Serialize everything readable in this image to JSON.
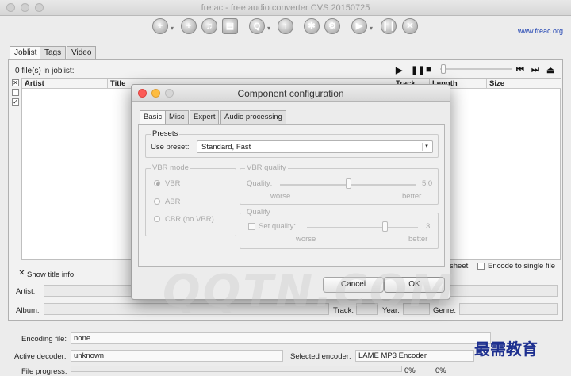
{
  "window": {
    "title": "fre:ac - free audio converter CVS 20150725",
    "link": "www.freac.org"
  },
  "main_tabs": [
    "Joblist",
    "Tags",
    "Video"
  ],
  "joblist": {
    "file_count": "0 file(s) in joblist:",
    "columns": [
      "Artist",
      "Title",
      "Track",
      "Length",
      "Size"
    ]
  },
  "tag_panel": {
    "show_title_info": "Show title info",
    "artist_label": "Artist:",
    "album_label": "Album:",
    "track_label": "Track:",
    "year_label": "Year:",
    "genre_label": "Genre:",
    "cue_sheet_fragment": "sheet",
    "encode_single_file": "Encode to single file"
  },
  "status": {
    "encoding_file_label": "Encoding file:",
    "encoding_file_value": "none",
    "active_decoder_label": "Active decoder:",
    "active_decoder_value": "unknown",
    "selected_encoder_label": "Selected encoder:",
    "selected_encoder_value": "LAME MP3 Encoder",
    "file_progress_label": "File progress:",
    "percent_a": "0%",
    "percent_b": "0%"
  },
  "dialog": {
    "title": "Component configuration",
    "tabs": [
      "Basic",
      "Misc",
      "Expert",
      "Audio processing"
    ],
    "presets_title": "Presets",
    "use_preset_label": "Use preset:",
    "use_preset_value": "Standard, Fast",
    "vbr_mode_title": "VBR mode",
    "vbr_options": [
      "VBR",
      "ABR",
      "CBR (no VBR)"
    ],
    "vbr_quality_title": "VBR quality",
    "quality_label": "Quality:",
    "quality_value": "5.0",
    "quality_fraction": 0.5,
    "worse": "worse",
    "better": "better",
    "quality_group_title": "Quality",
    "set_quality_label": "Set quality:",
    "set_quality_value": "3",
    "set_quality_fraction": 0.7,
    "cancel": "Cancel",
    "ok": "OK"
  },
  "watermark": "QQTN.COM",
  "corner_logo": "最需教育"
}
